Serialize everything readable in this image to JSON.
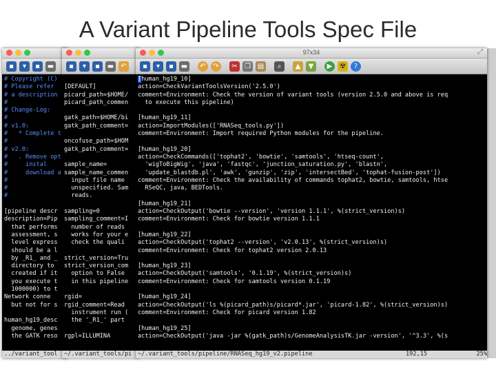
{
  "slide": {
    "title": "A Variant Pipeline Tools Spec File"
  },
  "window_main": {
    "title": "97x34"
  },
  "icons": [
    "new-file",
    "open",
    "save",
    "print",
    "undo",
    "redo",
    "cut",
    "copy",
    "paste",
    "find",
    "load-session",
    "save-session",
    "run",
    "make",
    "help"
  ],
  "colors": {
    "comment": "#5c8dff",
    "keyword": "#4fd14f",
    "text": "#f2f2f2",
    "background": "#000000",
    "cursor": "#2a5bff"
  },
  "left_lines": [
    "# Copyright (C)",
    "# Please refer",
    "# a description",
    "#",
    "# Change-Log:",
    "#",
    "# v1.0:",
    "#   * Complete t",
    "#",
    "# v2.0:",
    "#   . Remove opt",
    "#     instal",
    "#     download a",
    "#",
    "#",
    "#",
    "",
    "[pipeline descr",
    "description=Pip",
    "  that performs",
    "  assessment, s",
    "  level express",
    "  should be a l",
    "  by _R1_ and _",
    "  directory to",
    "  created if it",
    "  you execute t",
    "  1000000) to t",
    "Network conne",
    "  but not for s",
    "",
    "human_hg19_desc",
    "  genome, genes",
    "  the GATK reso",
    "../variant_tool"
  ],
  "middle_lines": [
    "",
    "[DEFAULT]",
    "picard_path=$HOME/",
    "picard_path_commen",
    "",
    "gatk_path=$HOME/bi",
    "gatk_path_comment=",
    "",
    "oncofuse_path=$HOM",
    "gatk_path_comment=",
    "",
    "sample_name=",
    "sample_name_commen",
    "  input file name",
    "  unspecified. Sam",
    "  reads.",
    "",
    "sampling=0",
    "sampling_comment=I",
    "  number of reads",
    "  works for your e",
    "  check the quali",
    "",
    "strict_version=Tru",
    "strict_version_com",
    "  option to False",
    "  in this pipeline",
    "",
    "rgid=",
    "rgid_comment=Read",
    "  instrument run (",
    "  the '_R1_' part",
    "",
    "rgpl=ILLUMINA",
    "~/.variant_tools/pi"
  ],
  "main_lines": [
    "[human_hg19_10]",
    "action=CheckVariantToolsVersion('2.5.0')",
    "comment=Environment: Check the version of variant tools (version 2.5.0 and above is req",
    "  to execute this pipeline)",
    "",
    "[human_hg19_11]",
    "action=ImportModules(['RNASeq_tools.py'])",
    "comment=Environment: Import required Python modules for the pipeline.",
    "",
    "[human_hg19_20]",
    "action=CheckCommands(['tophat2', 'bowtie', 'samtools', 'htseq-count',",
    "  'wigToBigWig', 'java', 'fastqc', 'junction_saturation.py', 'blastn',",
    "  'update_blastdb.pl', 'awk', 'gunzip', 'zip', 'intersectBed', 'tophat-fusion-post'])",
    "comment=Environment: Check the availability of commands tophat2, bowtie, samtools, htse",
    "  RSeQC, java, BEDTools.",
    "",
    "[human_hg19_21]",
    "action=CheckOutput('bowtie --version', 'version 1.1.1', %(strict_version)s)",
    "comment=Environment: Check for bowtie version 1.1.1",
    "",
    "[human_hg19_22]",
    "action=CheckOutput('tophat2 --version', 'v2.0.13', %(strict_version)s)",
    "comment=Environment: Check for tophat2 version 2.0.13",
    "",
    "[human_hg19_23]",
    "action=CheckOutput('samtools', '0.1.19', %(strict_version)s)",
    "comment=Environment: Check for samtools version 0.1.19",
    "",
    "[human_hg19_24]",
    "action=CheckOutput('ls %(picard_path)s/picard*.jar', 'picard-1.82', %(strict_version)s)",
    "comment=Environment: Check for picard version 1.82",
    "",
    "[human_hg19_25]",
    "action=CheckOutput('java -jar %(gatk_path)s/GenomeAnalysisTK.jar -version', '^3.3', %(s"
  ],
  "status": {
    "file": "~/.variant_tools/pipeline/RNASeq_hg19_v2.pipeline",
    "position": "192,15",
    "percent": "25%"
  }
}
